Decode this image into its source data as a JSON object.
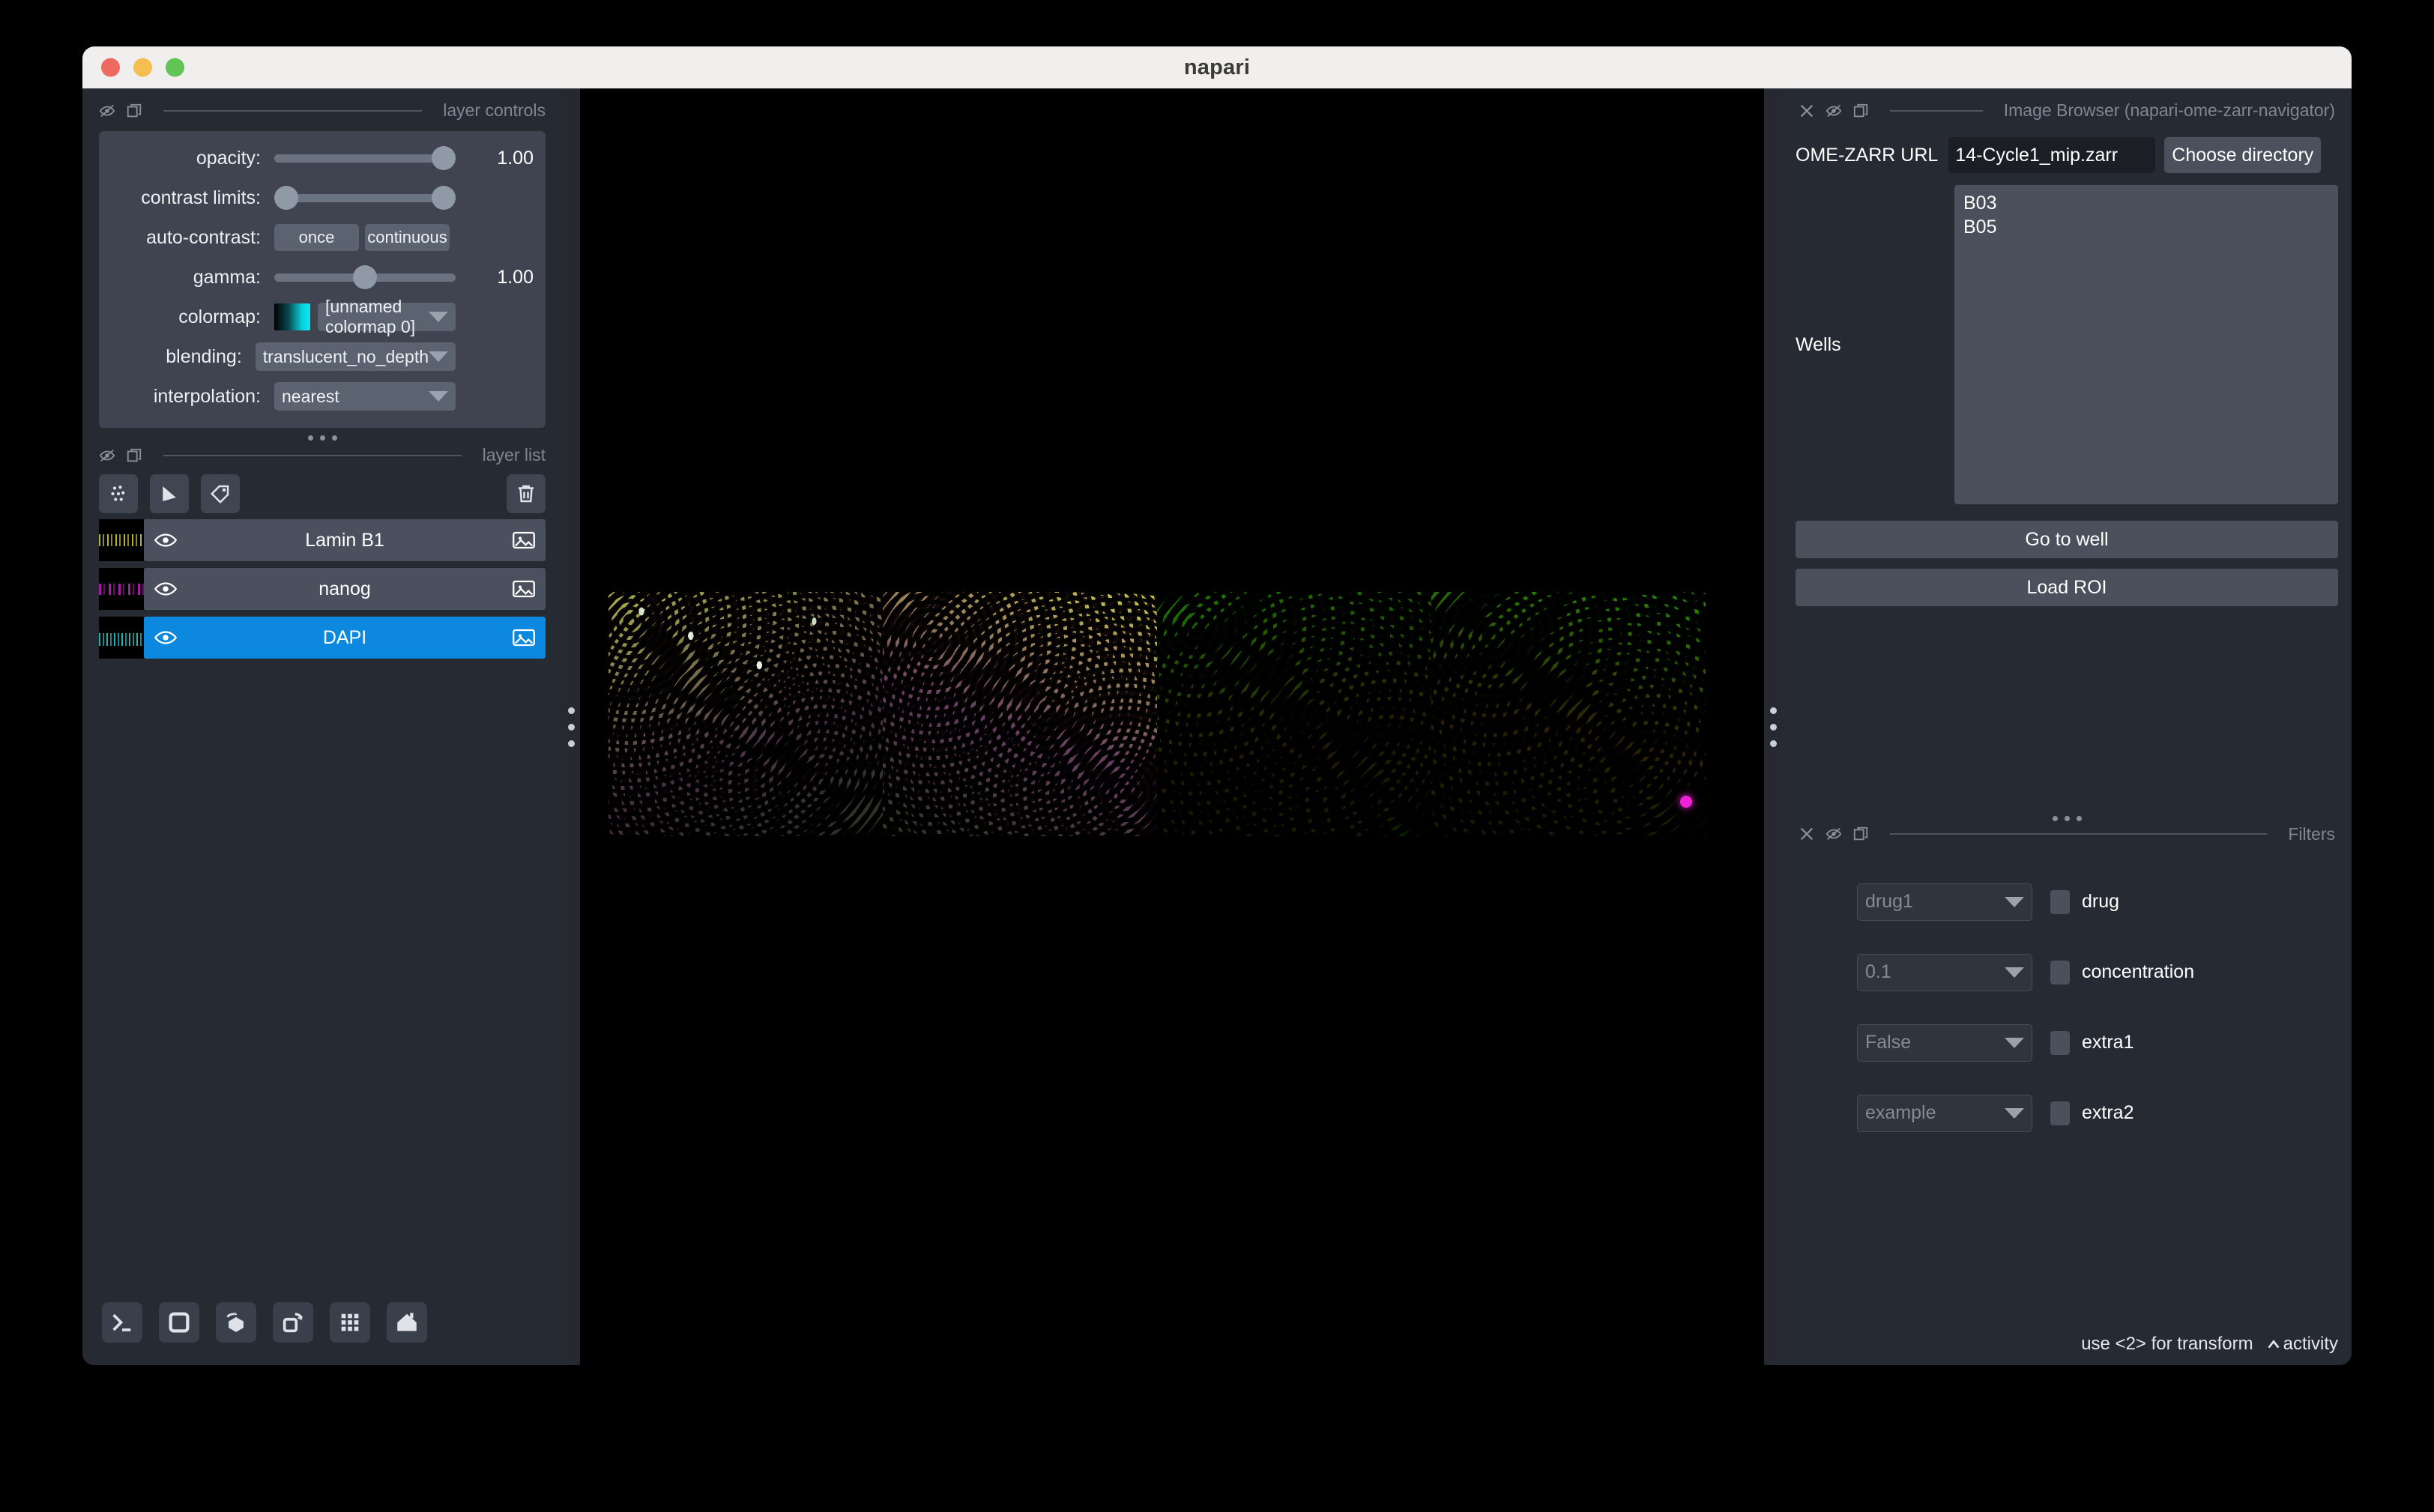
{
  "window": {
    "title": "napari",
    "traffic_lights": [
      "close",
      "minimize",
      "maximize"
    ]
  },
  "layer_controls": {
    "panel_title": "layer controls",
    "rows": {
      "opacity": {
        "label": "opacity:",
        "value": "1.00",
        "knob_pct": 100
      },
      "contrast_limits": {
        "label": "contrast limits:",
        "low_pct": 0,
        "high_pct": 100
      },
      "auto_contrast": {
        "label": "auto-contrast:",
        "once": "once",
        "continuous": "continuous"
      },
      "gamma": {
        "label": "gamma:",
        "value": "1.00",
        "knob_pct": 50
      },
      "colormap": {
        "label": "colormap:",
        "value": "[unnamed colormap 0]",
        "swatch_start": "#000000",
        "swatch_end": "#10e6f2"
      },
      "blending": {
        "label": "blending:",
        "value": "translucent_no_depth"
      },
      "interpolation": {
        "label": "interpolation:",
        "value": "nearest"
      }
    }
  },
  "layer_list": {
    "panel_title": "layer list",
    "tools": [
      "points-icon",
      "shapes-icon",
      "labels-icon"
    ],
    "delete_icon": "trash-icon",
    "layers": [
      {
        "name": "Lamin B1",
        "visible": true,
        "selected": false,
        "thumb_color": "#c8c832"
      },
      {
        "name": "nanog",
        "visible": true,
        "selected": false,
        "thumb_color": "#c819c8"
      },
      {
        "name": "DAPI",
        "visible": true,
        "selected": true,
        "thumb_color": "#1fc8c8"
      }
    ]
  },
  "viewer_buttons": [
    {
      "name": "console-button",
      "icon": "terminal-icon"
    },
    {
      "name": "ndisplay-2d-button",
      "icon": "square-icon"
    },
    {
      "name": "ndisplay-3d-button",
      "icon": "cube-rotate-icon"
    },
    {
      "name": "roll-dims-button",
      "icon": "square-rotate-icon"
    },
    {
      "name": "transpose-button",
      "icon": "grid-icon"
    },
    {
      "name": "home-button",
      "icon": "home-icon"
    }
  ],
  "image_browser": {
    "panel_title": "Image Browser (napari-ome-zarr-navigator)",
    "url_label": "OME-ZARR URL",
    "url_value": "14-Cycle1_mip.zarr",
    "choose_directory": "Choose directory",
    "wells_label": "Wells",
    "wells": [
      "B03",
      "B05"
    ],
    "go_to_well": "Go to well",
    "load_roi": "Load ROI"
  },
  "filters": {
    "panel_title": "Filters",
    "rows": [
      {
        "value": "drug1",
        "label": "drug",
        "checked": false
      },
      {
        "value": "0.1",
        "label": "concentration",
        "checked": false
      },
      {
        "value": "False",
        "label": "extra1",
        "checked": false
      },
      {
        "value": "example",
        "label": "extra2",
        "checked": false
      }
    ]
  },
  "status_bar": {
    "message": "use <2> for transform",
    "activity_label": "activity"
  },
  "canvas": {
    "background": "#000000",
    "tiles": [
      {
        "name": "tile-1",
        "width": 186
      },
      {
        "name": "tile-2",
        "width": 186
      },
      {
        "name": "tile-3",
        "width": 186
      },
      {
        "name": "tile-4",
        "width": 186
      }
    ]
  }
}
